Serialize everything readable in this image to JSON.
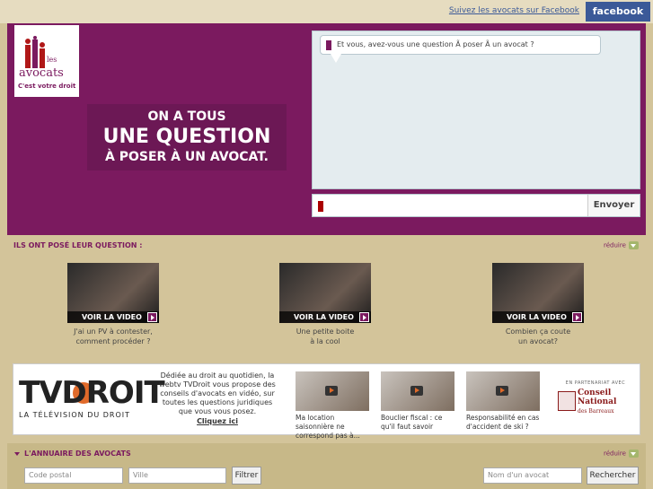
{
  "topbar": {
    "facebook_link": "Suivez les avocats sur Facebook",
    "facebook_button": "facebook"
  },
  "logo": {
    "les": "les",
    "avocats": "avocats",
    "tagline": "C'est votre droit"
  },
  "slogan": {
    "line1": "ON A TOUS",
    "line2": "UNE QUESTION",
    "line3": "À POSER À UN AVOCAT."
  },
  "chat": {
    "prompt": "Et vous, avez-vous une question Ã  poser Ã  un avocat ?",
    "input_value": "",
    "send_label": "Envoyer"
  },
  "questions_section": {
    "title": "ILS ONT POSÉ LEUR QUESTION :",
    "reduce_label": "réduire",
    "videos": [
      {
        "bar_label": "VOIR LA VIDEO",
        "caption_l1": "J'ai un PV à contester,",
        "caption_l2": "comment procéder ?"
      },
      {
        "bar_label": "VOIR LA VIDEO",
        "caption_l1": "Une petite boite",
        "caption_l2": "à la cool"
      },
      {
        "bar_label": "VOIR LA VIDEO",
        "caption_l1": "Combien ça coute",
        "caption_l2": "un avocat?"
      }
    ]
  },
  "tvdroit": {
    "logo_text": "TVDROIT",
    "logo_sub": "LA TÉLÉVISION DU DROIT",
    "description": "Dédiée au droit au quotidien, la webtv TVDroit vous propose des conseils d'avocats en vidéo, sur toutes les questions juridiques que vous vous posez.",
    "cta": "Cliquez ici",
    "videos": [
      {
        "caption": "Ma location saisonnière ne correspond pas à..."
      },
      {
        "caption": "Bouclier fiscal : ce qu'il faut savoir"
      },
      {
        "caption": "Responsabilité en cas d'accident de ski ?"
      }
    ],
    "partner_small": "EN PARTENARIAT AVEC",
    "partner_name_l1": "Conseil",
    "partner_name_l2": "National",
    "partner_name_l3": "des Barreaux"
  },
  "annuaire": {
    "title": "L'ANNUAIRE DES AVOCATS",
    "reduce_label": "réduire",
    "postal_placeholder": "Code postal",
    "city_placeholder": "Ville",
    "filter_label": "Filtrer",
    "name_placeholder": "Nom d'un avocat",
    "search_label": "Rechercher"
  },
  "colors": {
    "brand": "#7b1a5f",
    "background": "#d3c49a",
    "facebook": "#3b5998"
  }
}
